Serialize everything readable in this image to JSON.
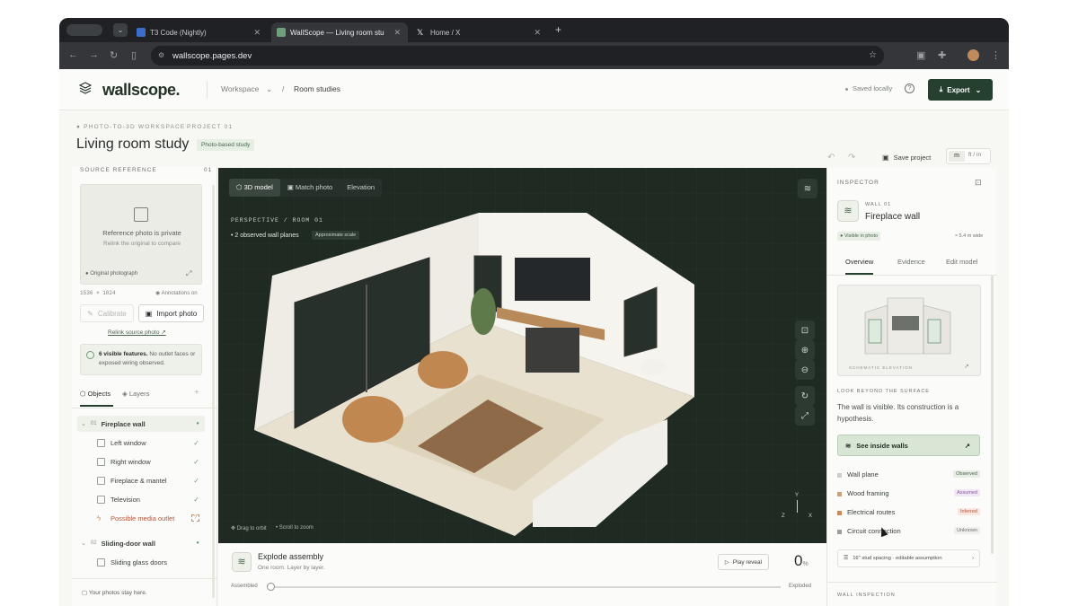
{
  "browser": {
    "tabs": [
      {
        "label": "T3 Code (Nightly)",
        "favicon_color": "#3b6ec9"
      },
      {
        "label": "WallScope — Living room stu",
        "favicon_color": "#6fa07a"
      },
      {
        "label": "Home / X",
        "favicon_color": "#ffffff"
      }
    ],
    "url": "wallscope.pages.dev"
  },
  "header": {
    "logo": "wallscope.",
    "crumb_workspace": "Workspace",
    "crumb_sep": "/",
    "crumb_page": "Room studies",
    "saved": "Saved locally",
    "export": "Export"
  },
  "project": {
    "kicker": "PHOTO-TO-3D WORKSPACE",
    "project_num": "PROJECT 01",
    "title": "Living room study",
    "badge": "Photo-based study",
    "save": "Save project",
    "unit_m": "m",
    "unit_ft": "ft / in"
  },
  "left": {
    "source_label": "SOURCE REFERENCE",
    "source_num": "01",
    "private_title": "Reference photo is private",
    "private_sub": "Relink the original to compare",
    "original": "Original photograph",
    "resolution": "1536 × 1024",
    "annotations": "Annotations on",
    "calibrate": "Calibrate",
    "import": "Import photo",
    "relink": "Relink source photo",
    "features_bold": "6 visible features.",
    "features_rest": " No outlet faces or exposed wiring observed.",
    "tab_objects": "Objects",
    "tab_layers": "Layers",
    "groups": [
      {
        "num": "01",
        "label": "Fireplace wall",
        "items": [
          {
            "label": "Left window",
            "check": "✓"
          },
          {
            "label": "Right window",
            "check": "✓"
          },
          {
            "label": "Fireplace & mantel",
            "check": "✓"
          },
          {
            "label": "Television",
            "check": "✓"
          },
          {
            "label": "Possible media outlet",
            "check": "?"
          }
        ]
      },
      {
        "num": "02",
        "label": "Sliding-door wall",
        "items": [
          {
            "label": "Sliding glass doors",
            "check": "✓"
          }
        ]
      }
    ],
    "footer": "Your photos stay here."
  },
  "viewport": {
    "modes": [
      "3D model",
      "Match photo",
      "Elevation"
    ],
    "perspective": "PERSPECTIVE / ROOM 01",
    "planes": "2 observed wall planes",
    "scale": "Approximate scale",
    "drag": "Drag to orbit",
    "scroll": "Scroll to zoom",
    "axis_y": "Y",
    "axis_x": "X",
    "axis_z": "Z"
  },
  "explode": {
    "title": "Explode assembly",
    "sub": "One room. Layer by layer.",
    "play": "Play reveal",
    "value": "0",
    "unit": "%",
    "left_label": "Assembled",
    "right_label": "Exploded",
    "progress": 0
  },
  "inspector": {
    "label": "INSPECTOR",
    "wall_num": "WALL 01",
    "wall_name": "Fireplace wall",
    "visible": "Visible in photo",
    "width": "≈ 5.4 m wide",
    "tabs": [
      "Overview",
      "Evidence",
      "Edit model"
    ],
    "schematic": "SCHEMATIC ELEVATION",
    "beyond_label": "LOOK BEYOND THE SURFACE",
    "beyond_text": "The wall is visible. Its construction is a hypothesis.",
    "see_inside": "See inside walls",
    "layers": [
      {
        "label": "Wall plane",
        "tag": "Observed",
        "color": "#cfcfc8",
        "tag_color": "#4a6650",
        "tag_bg": "#e7eee4"
      },
      {
        "label": "Wood framing",
        "tag": "Assumed",
        "color": "#c9a27a",
        "tag_color": "#8a5aa8",
        "tag_bg": "#f1e7f5"
      },
      {
        "label": "Electrical routes",
        "tag": "Inferred",
        "color": "#d08a5a",
        "tag_color": "#b2553a",
        "tag_bg": "#f8e6df"
      },
      {
        "label": "Circuit connection",
        "tag": "Unknown",
        "color": "#9a9f9a",
        "tag_color": "#6d726d",
        "tag_bg": "#efefeb"
      }
    ],
    "stud": "16\" stud spacing · editable assumption",
    "wall_inspection": "WALL INSPECTION"
  }
}
